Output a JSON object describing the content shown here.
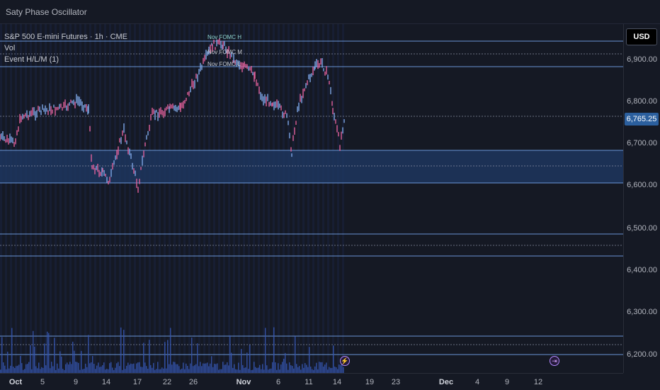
{
  "topbar": {
    "title": "Saty Phase Oscillator"
  },
  "legend": {
    "symbol": "S&P 500 E-mini Futures · 1h · CME",
    "vol": "Vol",
    "indicator": "Event H/L/M (1)"
  },
  "hl_labels": {
    "high": "Nov FOMC H",
    "mid": "Nov FOMC M",
    "low": "Nov FOMC L"
  },
  "currency": "USD",
  "current_price": "6,765.25",
  "price_ticks": [
    "6,900.00",
    "6,800.00",
    "6,700.00",
    "6,600.00",
    "6,500.00",
    "6,400.00",
    "6,300.00",
    "6,200.00"
  ],
  "time_ticks": [
    {
      "label": "Oct",
      "major": true
    },
    {
      "label": "5",
      "major": false
    },
    {
      "label": "9",
      "major": false
    },
    {
      "label": "14",
      "major": false
    },
    {
      "label": "17",
      "major": false
    },
    {
      "label": "22",
      "major": false
    },
    {
      "label": "26",
      "major": false
    },
    {
      "label": "Nov",
      "major": true
    },
    {
      "label": "6",
      "major": false
    },
    {
      "label": "11",
      "major": false
    },
    {
      "label": "14",
      "major": false
    },
    {
      "label": "19",
      "major": false
    },
    {
      "label": "23",
      "major": false
    },
    {
      "label": "Dec",
      "major": true
    },
    {
      "label": "4",
      "major": false
    },
    {
      "label": "9",
      "major": false
    },
    {
      "label": "12",
      "major": false
    }
  ],
  "event_icons": {
    "first": "⚡",
    "second": "⇥"
  },
  "colors": {
    "up": "#7ea6e6",
    "down": "#e0609a",
    "level_line": "#7fb3ff",
    "band": "#1f3a66",
    "accent": "#2b5f9e"
  }
}
